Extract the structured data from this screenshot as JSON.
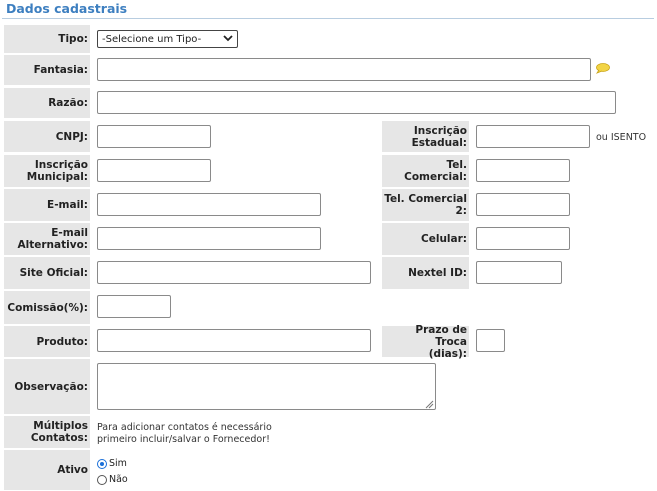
{
  "section": {
    "title": "Dados cadastrais"
  },
  "form": {
    "tipo": {
      "label": "Tipo:",
      "selected": "-Selecione um Tipo-"
    },
    "fantasia": {
      "label": "Fantasia:",
      "value": "",
      "comment_icon": "comment-icon"
    },
    "razao": {
      "label": "Razão:",
      "value": ""
    },
    "cnpj": {
      "label": "CNPJ:",
      "value": ""
    },
    "inscricao_estadual": {
      "label_line1": "Inscrição",
      "label_line2": "Estadual:",
      "value": "",
      "suffix": "ou ISENTO"
    },
    "inscricao_municipal": {
      "label_line1": "Inscrição",
      "label_line2": "Municipal:",
      "value": ""
    },
    "tel_comercial": {
      "label": "Tel. Comercial:",
      "value": ""
    },
    "email": {
      "label": "E-mail:",
      "value": ""
    },
    "tel_comercial_2": {
      "label_line1": "Tel. Comercial",
      "label_line2": "2:",
      "value": ""
    },
    "email_alternativo": {
      "label_line1": "E-mail",
      "label_line2": "Alternativo:",
      "value": ""
    },
    "celular": {
      "label": "Celular:",
      "value": ""
    },
    "site_oficial": {
      "label": "Site Oficial:",
      "value": ""
    },
    "nextel_id": {
      "label": "Nextel ID:",
      "value": ""
    },
    "comissao": {
      "label": "Comissão(%):",
      "value": ""
    },
    "produto": {
      "label": "Produto:",
      "value": ""
    },
    "prazo_troca": {
      "label_line1": "Prazo de Troca",
      "label_line2": "(dias):",
      "value": ""
    },
    "observacao": {
      "label": "Observação:",
      "value": ""
    },
    "multiplos_contatos": {
      "label_line1": "Múltiplos",
      "label_line2": "Contatos:",
      "note_line1": "Para adicionar contatos é necessário",
      "note_line2": "primeiro incluir/salvar o Fornecedor!"
    },
    "ativo": {
      "label": "Ativo",
      "options": [
        {
          "label": "Sim",
          "checked": true
        },
        {
          "label": "Não",
          "checked": false
        }
      ]
    }
  },
  "colors": {
    "title": "#3d7fc0",
    "label_bg": "#e6e6e6",
    "radio_accent": "#1a6fd8"
  }
}
